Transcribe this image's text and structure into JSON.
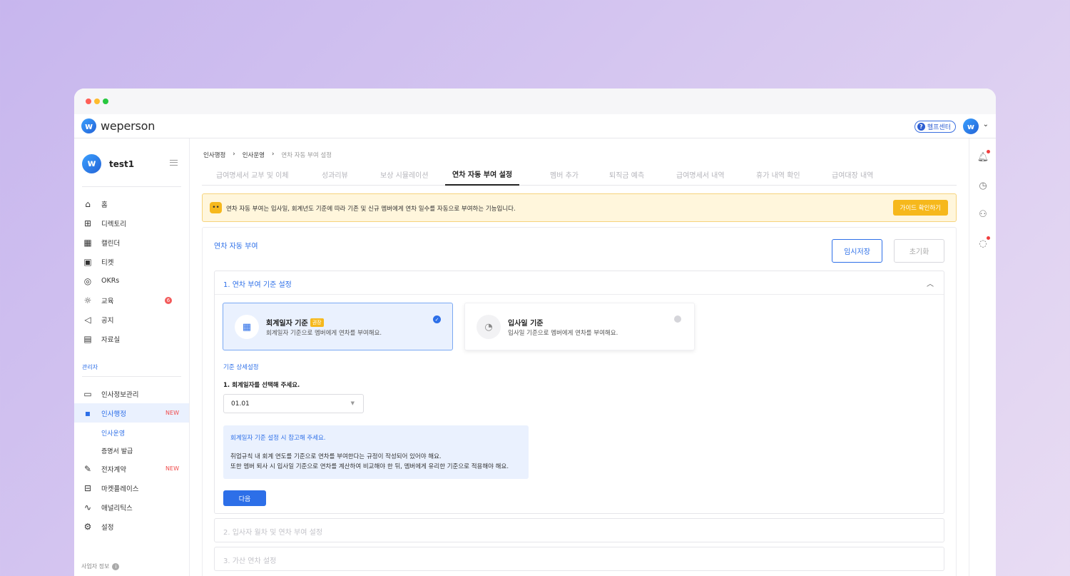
{
  "app": {
    "logo_text": "weperson",
    "help_label": "헬프센터"
  },
  "sidebar": {
    "user_name": "test1",
    "items": [
      {
        "label": "홈",
        "icon": "home-icon"
      },
      {
        "label": "디렉토리",
        "icon": "org-chart-icon"
      },
      {
        "label": "캘린더",
        "icon": "calendar-icon"
      },
      {
        "label": "티켓",
        "icon": "ticket-icon"
      },
      {
        "label": "OKRs",
        "icon": "target-icon"
      },
      {
        "label": "교육",
        "icon": "lightbulb-icon",
        "badge": "6"
      },
      {
        "label": "공지",
        "icon": "megaphone-icon"
      },
      {
        "label": "자료실",
        "icon": "archive-icon"
      }
    ],
    "admin_label": "관리자",
    "admin_items": [
      {
        "label": "인사정보관리",
        "icon": "folder-person-icon"
      },
      {
        "label": "인사행정",
        "icon": "save-icon",
        "tag": "NEW"
      },
      {
        "label": "전자계약",
        "icon": "contract-icon",
        "tag": "NEW"
      },
      {
        "label": "마켓플레이스",
        "icon": "gift-icon"
      },
      {
        "label": "애널리틱스",
        "icon": "chart-line-icon"
      },
      {
        "label": "설정",
        "icon": "gear-icon"
      }
    ],
    "sub_items": [
      "인사운영",
      "증명서 발급"
    ],
    "biz_info": "사업자 정보"
  },
  "breadcrumb": [
    "인사행정",
    "인사운영",
    "연차 자동 부여 설정"
  ],
  "tabs": [
    "급여명세서 교부 및 이체",
    "성과리뷰",
    "보상 시뮬레이션",
    "연차 자동 부여 설정",
    "멤버 추가",
    "퇴직금 예측",
    "급여명세서 내역",
    "휴가 내역 확인",
    "급여대장 내역"
  ],
  "active_tab": "연차 자동 부여 설정",
  "notice": {
    "text": "연차 자동 부여는 입사일, 회계년도 기준에 따라 기존 및 신규 멤버에게 연차 일수를 자동으로 부여하는 기능입니다.",
    "button": "가이드 확인하기"
  },
  "card": {
    "title": "연차 자동 부여",
    "save_button": "임시저장",
    "reset_button": "초기화"
  },
  "sections": [
    {
      "title": "1. 연차 부여 기준 설정",
      "expanded": true
    },
    {
      "title": "2. 입사자 월차 및 연차 부여 설정",
      "expanded": false
    },
    {
      "title": "3. 가산 연차 설정",
      "expanded": false
    }
  ],
  "options": [
    {
      "title": "회계일자 기준",
      "tag": "권장",
      "desc": "회계일자 기준으로 멤버에게 연차를 부여해요.",
      "selected": true
    },
    {
      "title": "입사일 기준",
      "desc": "입사일 기준으로 멤버에게 연차를 부여해요.",
      "selected": false
    }
  ],
  "detail": {
    "label": "기준 상세설정",
    "question": "1. 회계일자를 선택해 주세요.",
    "selected_value": "01.01"
  },
  "reference": {
    "title": "회계일자 기준 설정 시 참고해 주세요.",
    "line1": "취업규칙 내 회계 연도를 기준으로 연차를 부여한다는 규정이 작성되어 있어야 해요.",
    "line2": "또한 멤버 퇴사 시 입사일 기준으로 연차를 계산하여 비교해야 한 뒤, 멤버에게 유리한 기준으로 적용해야 해요."
  },
  "next_button": "다음",
  "colors": {
    "accent": "#2d6fe8",
    "warning": "#f6b81c",
    "new_tag": "#f04a4a"
  }
}
